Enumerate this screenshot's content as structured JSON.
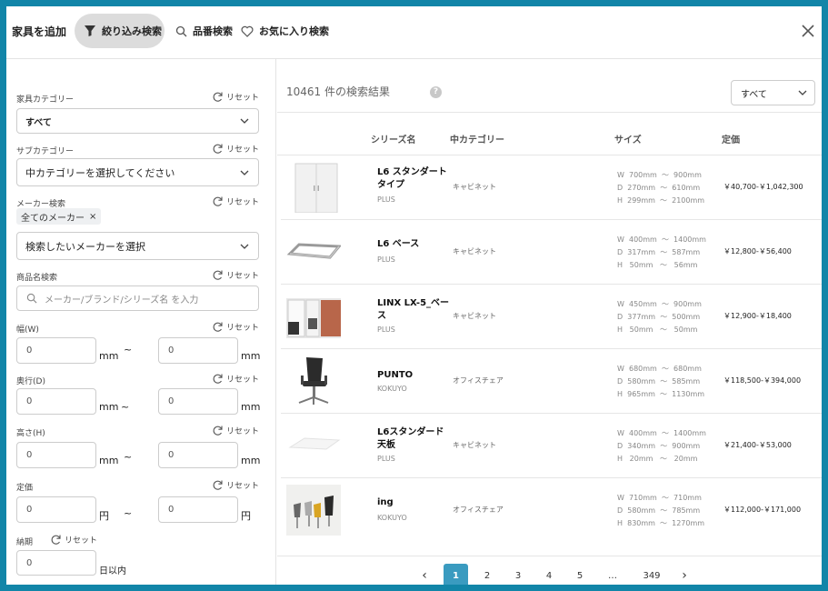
{
  "header": {
    "title": "家具を追加",
    "tabs": [
      {
        "label": "絞り込み検索",
        "icon": "filter-icon",
        "active": true
      },
      {
        "label": "品番検索",
        "icon": "search-icon",
        "active": false
      },
      {
        "label": "お気に入り検索",
        "icon": "heart-icon",
        "active": false
      }
    ],
    "close_icon": "close-icon"
  },
  "sidebar": {
    "reset_label": "リセット",
    "category": {
      "label": "家具カテゴリー",
      "value": "すべて"
    },
    "subcategory": {
      "label": "サブカテゴリー",
      "value": "中カテゴリーを選択してください"
    },
    "maker": {
      "label": "メーカー検索",
      "chip": "全てのメーカー",
      "chip_remove": "×",
      "select": "検索したいメーカーを選択"
    },
    "product_name": {
      "label": "商品名検索",
      "placeholder": "メーカー/ブランド/シリーズ名 を入力"
    },
    "width": {
      "label": "幅(W)",
      "min": "0",
      "max": "0",
      "unit": "mm",
      "sep": "~"
    },
    "depth": {
      "label": "奥行(D)",
      "min": "0",
      "max": "0",
      "unit": "mm",
      "sep": "~"
    },
    "height": {
      "label": "高さ(H)",
      "min": "0",
      "max": "0",
      "unit": "mm",
      "sep": "~"
    },
    "price": {
      "label": "定価",
      "min": "0",
      "max": "0",
      "unit": "円",
      "sep": "~"
    },
    "delivery": {
      "label": "納期",
      "value": "0",
      "unit": "日以内"
    }
  },
  "results": {
    "count": "10461 件の検索結果",
    "help_icon": "?",
    "sort_value": "すべて",
    "columns": [
      "シリーズ名",
      "中カテゴリー",
      "サイズ",
      "定価"
    ],
    "rows": [
      {
        "name": "L6 スタンダートタイプ",
        "maker": "PLUS",
        "category": "キャビネット",
        "size": "W  700mm  〜  900mm\nD  270mm  〜  610mm\nH  299mm  〜  2100mm",
        "price": "￥40,700-￥1,042,300",
        "thumb": "cabinet"
      },
      {
        "name": "L6 ベース",
        "maker": "PLUS",
        "category": "キャビネット",
        "size": "W  400mm  〜  1400mm\nD  317mm  〜  587mm\nH   50mm   〜   56mm",
        "price": "￥12,800-￥56,400",
        "thumb": "base"
      },
      {
        "name": "LINX LX-5_ベース",
        "maker": "PLUS",
        "category": "キャビネット",
        "size": "W  450mm  〜  900mm\nD  377mm  〜  500mm\nH   50mm   〜   50mm",
        "price": "￥12,900-￥18,400",
        "thumb": "lockers"
      },
      {
        "name": "PUNTO",
        "maker": "KOKUYO",
        "category": "オフィスチェア",
        "size": "W  680mm  〜  680mm\nD  580mm  〜  585mm\nH  965mm  〜  1130mm",
        "price": "￥118,500-￥394,000",
        "thumb": "chair"
      },
      {
        "name": "L6スタンダード天板",
        "maker": "PLUS",
        "category": "キャビネット",
        "size": "W  400mm  〜  1400mm\nD  340mm  〜  900mm\nH   20mm   〜   20mm",
        "price": "￥21,400-￥53,000",
        "thumb": "top"
      },
      {
        "name": "ing",
        "maker": "KOKUYO",
        "category": "オフィスチェア",
        "size": "W  710mm  〜  710mm\nD  580mm  〜  785mm\nH  830mm  〜  1270mm",
        "price": "￥112,000-￥171,000",
        "thumb": "chairs"
      }
    ]
  },
  "pagination": {
    "prev": "‹",
    "pages": [
      "1",
      "2",
      "3",
      "4",
      "5",
      "…",
      "349"
    ],
    "current": "1",
    "next": "›"
  },
  "colors": {
    "frame": "#1285a8",
    "active_page": "#3a9bc0",
    "active_tab": "#dcdcdc"
  }
}
